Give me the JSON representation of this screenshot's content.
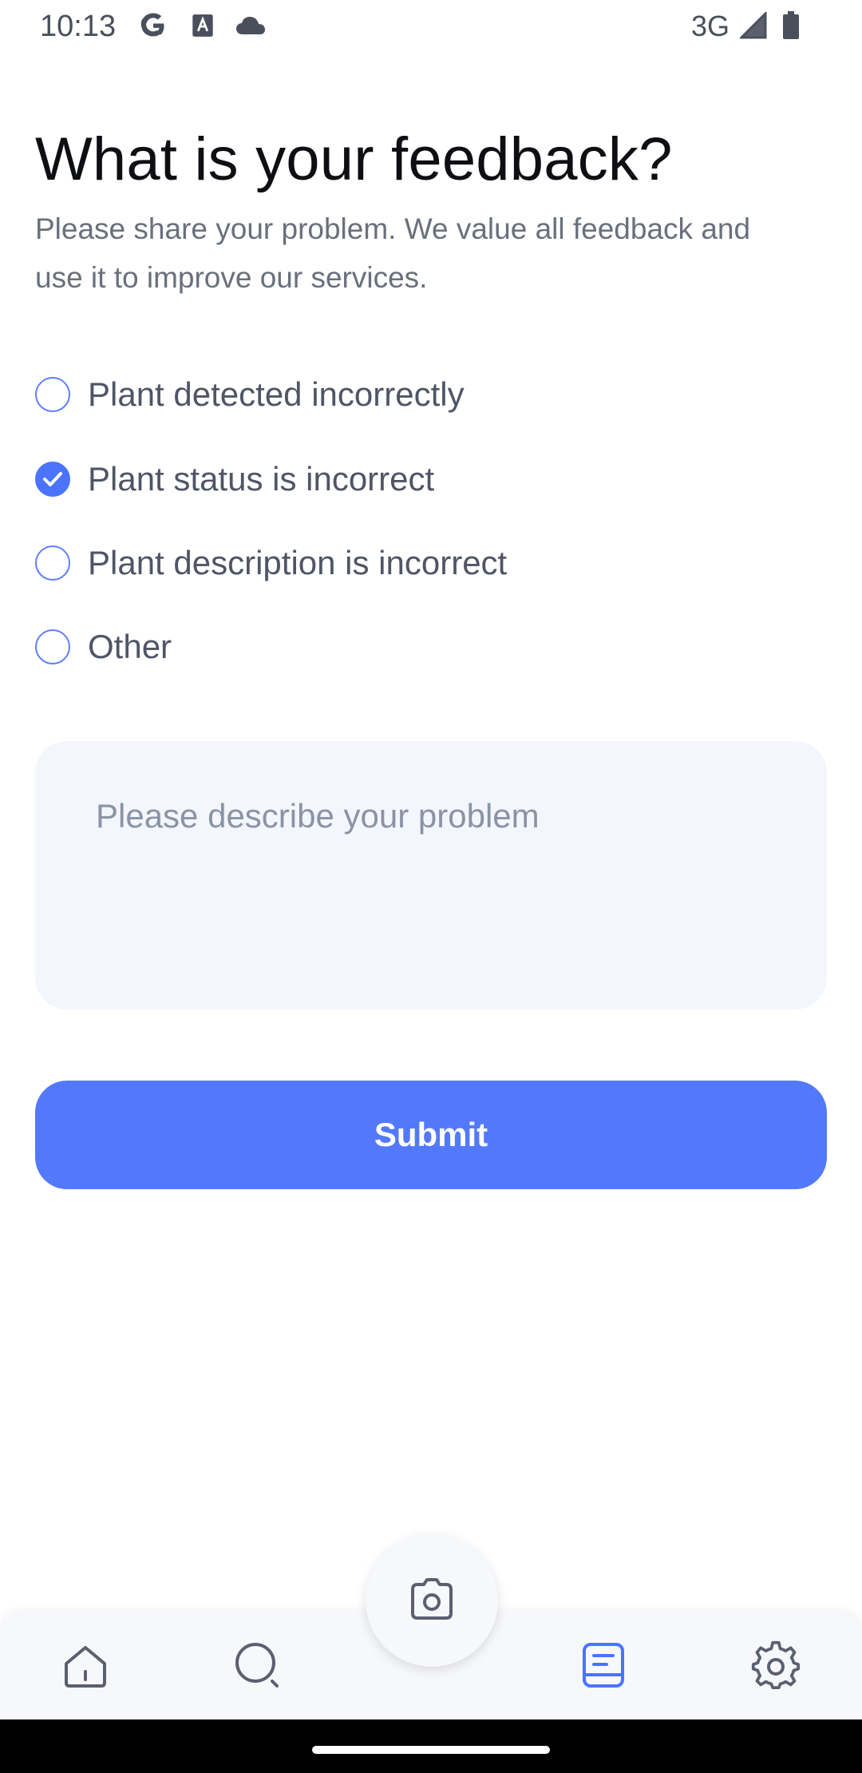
{
  "status_bar": {
    "time": "10:13",
    "network": "3G",
    "icons": [
      "google-icon",
      "font-a-icon",
      "cloud-icon",
      "signal-icon",
      "battery-icon"
    ]
  },
  "header": {
    "title": "What is your feedback?",
    "subtitle": "Please share your problem. We value all feedback and use it to improve our services."
  },
  "options": [
    {
      "label": "Plant detected incorrectly",
      "checked": false
    },
    {
      "label": "Plant status is incorrect",
      "checked": true
    },
    {
      "label": "Plant description is incorrect",
      "checked": false
    },
    {
      "label": "Other",
      "checked": false
    }
  ],
  "problem_input": {
    "value": "",
    "placeholder": "Please describe your problem"
  },
  "submit_label": "Submit",
  "bottom_nav": {
    "items": [
      {
        "icon": "home-icon",
        "active": false
      },
      {
        "icon": "search-icon",
        "active": false
      },
      {
        "icon": "camera-icon",
        "active": false
      },
      {
        "icon": "notes-icon",
        "active": true
      },
      {
        "icon": "gear-icon",
        "active": false
      }
    ]
  },
  "colors": {
    "accent": "#5379fb",
    "nav_inactive": "#5a6070",
    "text_secondary": "#6a6f7c",
    "input_bg": "#f3f6fc"
  }
}
